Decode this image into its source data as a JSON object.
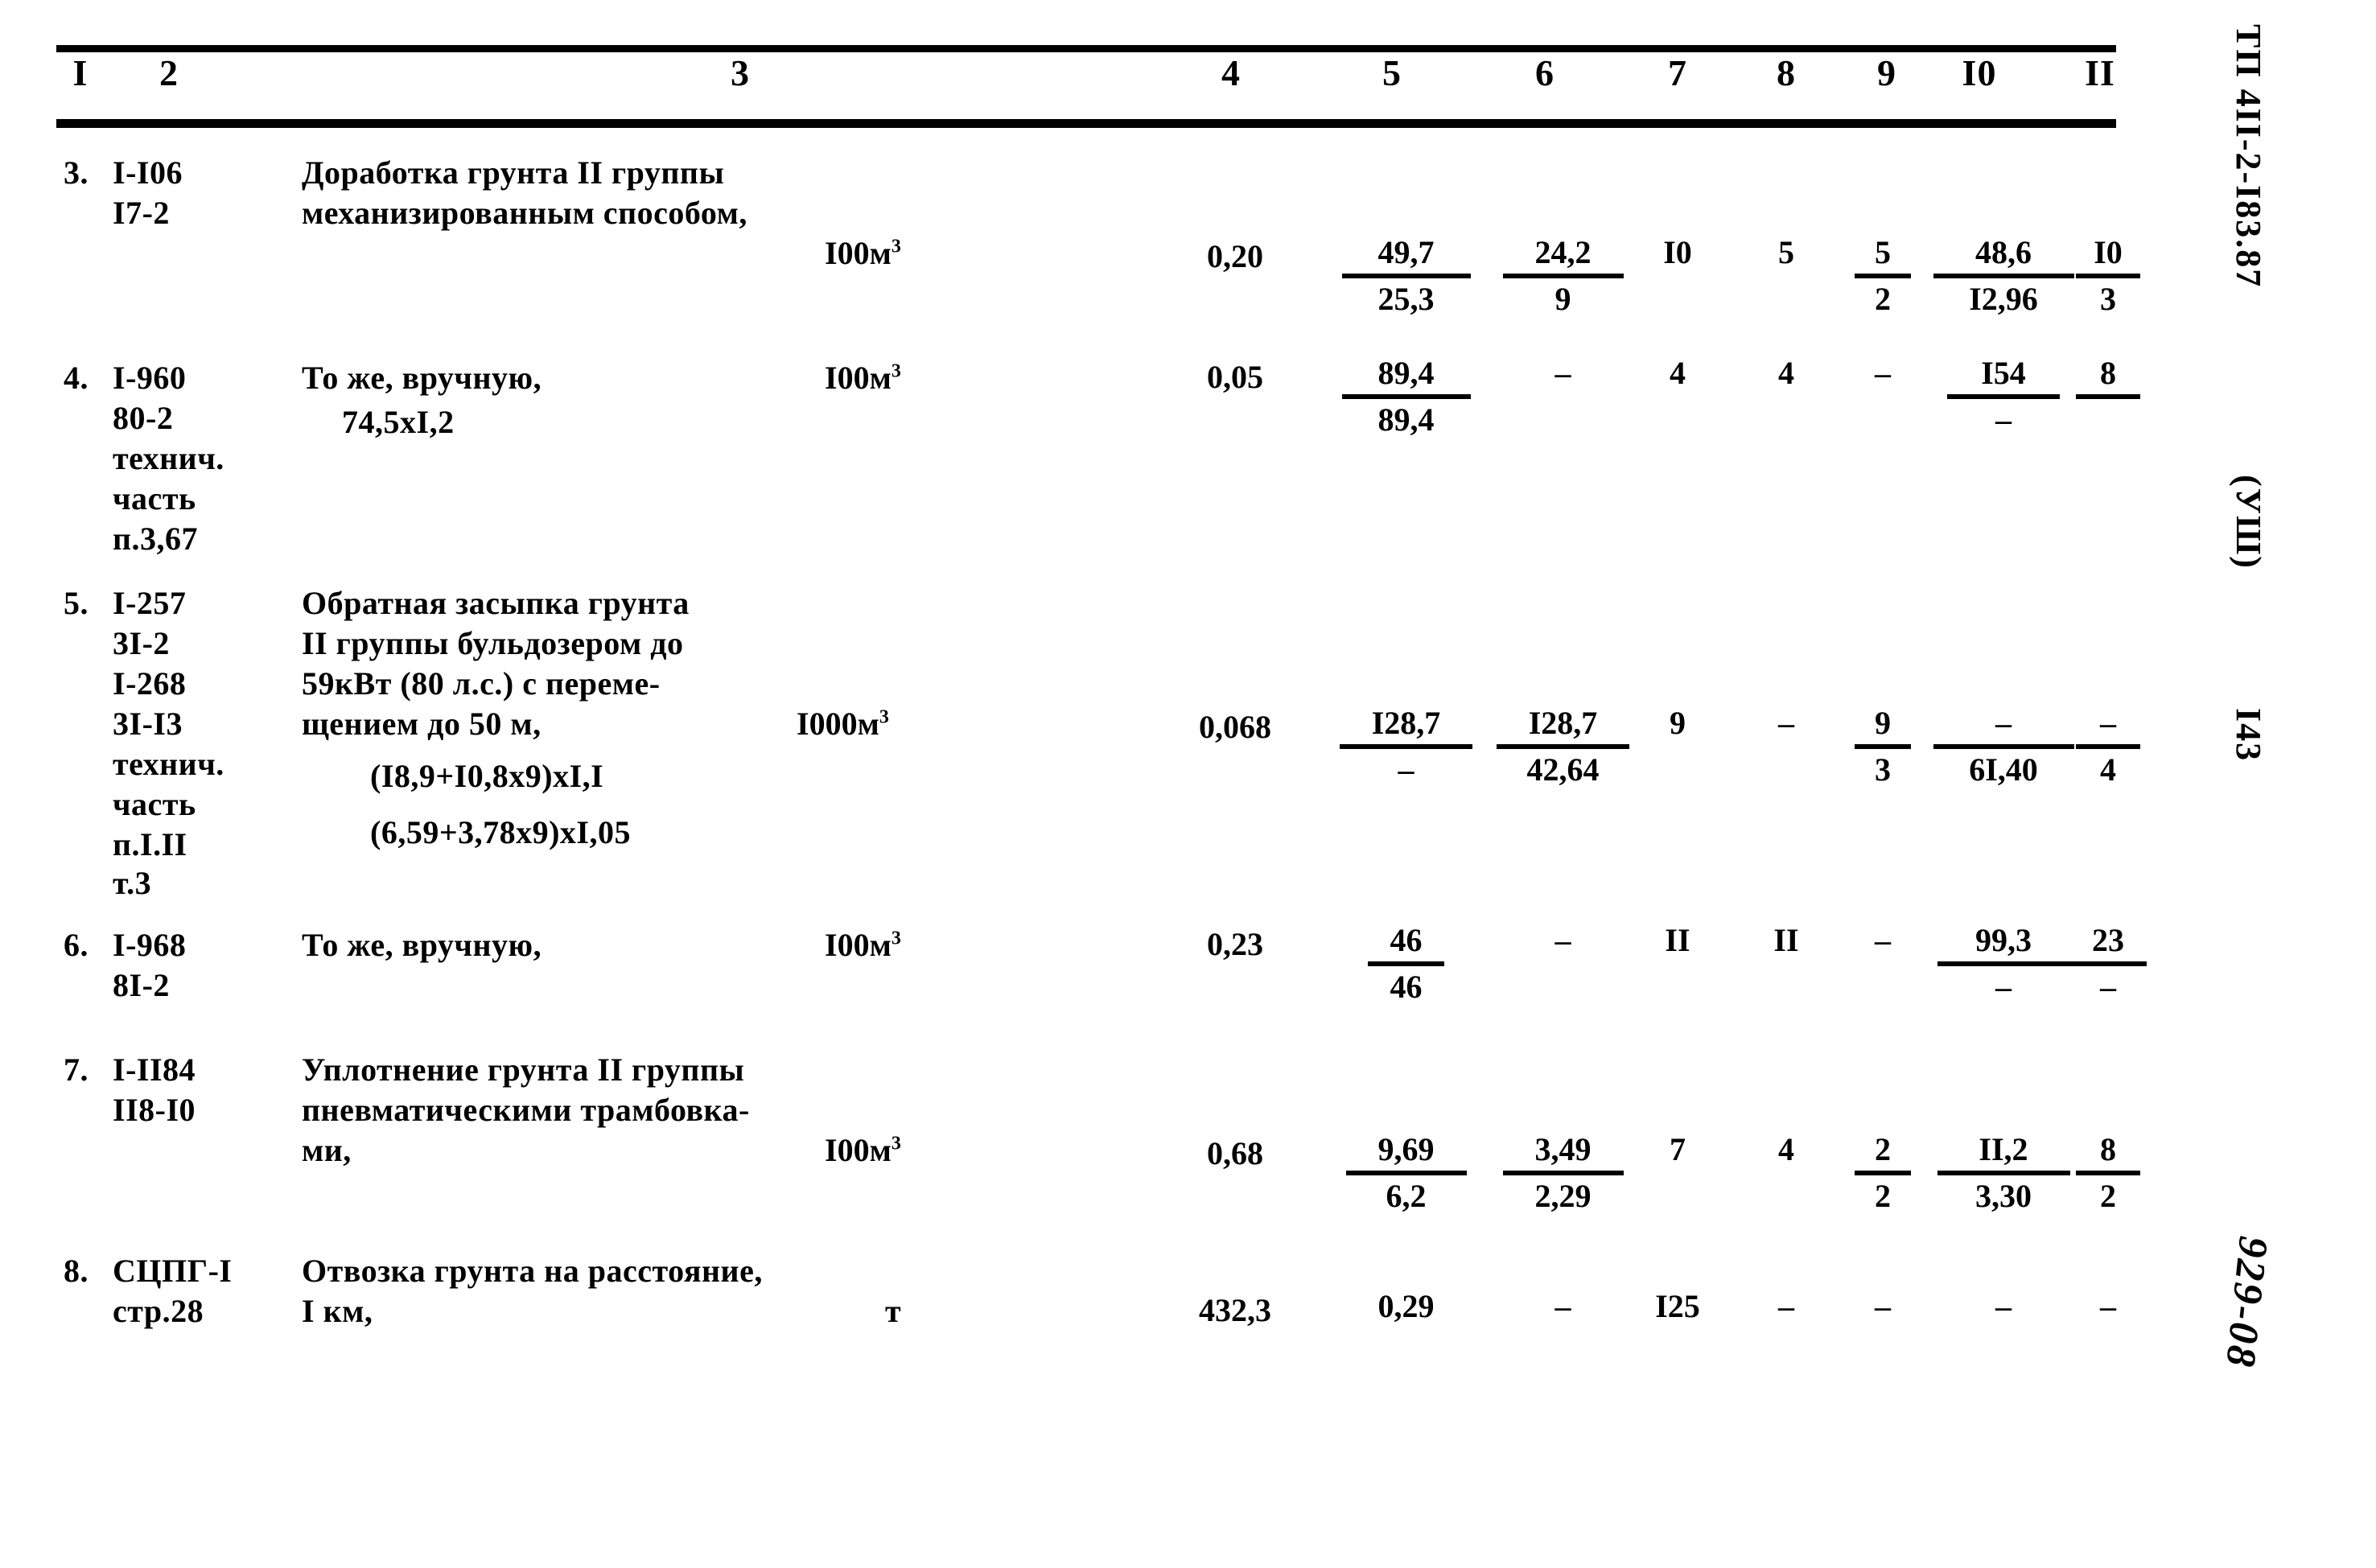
{
  "document": {
    "margin_code": "ТП 4II-2-I83.87",
    "margin_section": "(УШ)",
    "page_number": "I43",
    "handwritten_note": "929-08"
  },
  "table": {
    "column_headers": [
      "I",
      "2",
      "3",
      "4",
      "5",
      "6",
      "7",
      "8",
      "9",
      "I0",
      "II"
    ],
    "rows": [
      {
        "num": "3.",
        "codes": [
          "I-I06",
          "I7-2"
        ],
        "description": [
          "Доработка грунта II группы",
          "механизированным способом,"
        ],
        "unit": "I00м",
        "unit_sup": "3",
        "c4": "0,20",
        "c5": {
          "top": "49,7",
          "bot": "25,3",
          "bar": true
        },
        "c6": {
          "top": "24,2",
          "bot": "9",
          "bar": true
        },
        "c7": "I0",
        "c8": "5",
        "c9": {
          "top": "5",
          "bot": "2",
          "bar": true
        },
        "c10": {
          "top": "48,6",
          "bot": "I2,96",
          "bar": true
        },
        "c11": {
          "top": "I0",
          "bot": "3",
          "bar": true
        }
      },
      {
        "num": "4.",
        "codes": [
          "I-960",
          "80-2",
          "технич.",
          "часть",
          "п.3,67"
        ],
        "description": [
          "То же, вручную,",
          "",
          "74,5xI,2"
        ],
        "unit": "I00м",
        "unit_sup": "3",
        "c4": "0,05",
        "c5": {
          "top": "89,4",
          "bot": "89,4",
          "bar": true
        },
        "c6": {
          "top": "–",
          "bot": "",
          "bar": false
        },
        "c7": "4",
        "c8": "4",
        "c9": {
          "top": "–",
          "bot": "",
          "bar": false
        },
        "c10": {
          "top": "I54",
          "bot": "–",
          "bar": true
        },
        "c11": {
          "top": "8",
          "bot": "",
          "bar": true
        }
      },
      {
        "num": "5.",
        "codes": [
          "I-257",
          "3I-2",
          "I-268",
          "3I-I3",
          "технич.",
          "часть",
          "п.I.II",
          "т.3"
        ],
        "description": [
          "Обратная засыпка грунта",
          "II группы бульдозером до",
          "59кВт (80 л.с.) с переме-",
          "щением до 50 м,",
          "",
          "(I8,9+I0,8x9)xI,I",
          "",
          "(6,59+3,78x9)xI,05"
        ],
        "unit": "I000м",
        "unit_sup": "3",
        "c4": "0,068",
        "c5": {
          "top": "I28,7",
          "bot": "–",
          "bar": true
        },
        "c6": {
          "top": "I28,7",
          "bot": "42,64",
          "bar": true
        },
        "c7": "9",
        "c8": "–",
        "c9": {
          "top": "9",
          "bot": "3",
          "bar": true
        },
        "c10": {
          "top": "–",
          "bot": "6I,40",
          "bar": true
        },
        "c11": {
          "top": "–",
          "bot": "4",
          "bar": true
        }
      },
      {
        "num": "6.",
        "codes": [
          "I-968",
          "8I-2"
        ],
        "description": [
          "То же, вручную,"
        ],
        "unit": "I00м",
        "unit_sup": "3",
        "c4": "0,23",
        "c5": {
          "top": "46",
          "bot": "46",
          "bar": true
        },
        "c6": {
          "top": "–",
          "bot": "",
          "bar": false
        },
        "c7": "II",
        "c8": "II",
        "c9": {
          "top": "–",
          "bot": "",
          "bar": false
        },
        "c10": {
          "top": "99,3",
          "bot": "–",
          "bar": true
        },
        "c11": {
          "top": "23",
          "bot": "–",
          "bar": true
        }
      },
      {
        "num": "7.",
        "codes": [
          "I-II84",
          "II8-I0"
        ],
        "description": [
          "Уплотнение грунта II группы",
          "пневматическими трамбовка-",
          "ми,"
        ],
        "unit": "I00м",
        "unit_sup": "3",
        "c4": "0,68",
        "c5": {
          "top": "9,69",
          "bot": "6,2",
          "bar": true
        },
        "c6": {
          "top": "3,49",
          "bot": "2,29",
          "bar": true
        },
        "c7": "7",
        "c8": "4",
        "c9": {
          "top": "2",
          "bot": "2",
          "bar": true
        },
        "c10": {
          "top": "II,2",
          "bot": "3,30",
          "bar": true
        },
        "c11": {
          "top": "8",
          "bot": "2",
          "bar": true
        }
      },
      {
        "num": "8.",
        "codes": [
          "СЦПГ-I",
          "стр.28"
        ],
        "description": [
          "Отвозка грунта на расстояние,",
          "I км,"
        ],
        "unit": "т",
        "unit_sup": "",
        "c4": "432,3",
        "c5": {
          "top": "0,29",
          "bot": "",
          "bar": false
        },
        "c6": {
          "top": "–",
          "bot": "",
          "bar": false
        },
        "c7": "I25",
        "c8": "–",
        "c9": {
          "top": "–",
          "bot": "",
          "bar": false
        },
        "c10": {
          "top": "–",
          "bot": "",
          "bar": false
        },
        "c11": {
          "top": "–",
          "bot": "",
          "bar": false
        }
      }
    ]
  }
}
